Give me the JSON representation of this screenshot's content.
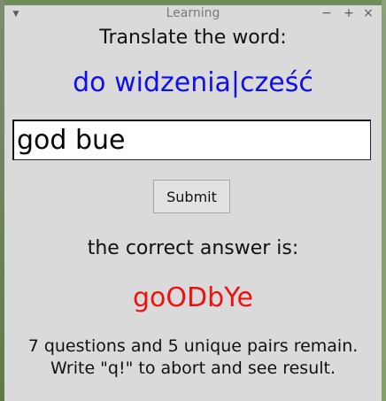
{
  "window": {
    "title": "Learning",
    "menu_icon": "chevron-down-icon",
    "controls": {
      "minimize": "−",
      "maximize": "+",
      "close": "×"
    }
  },
  "quiz": {
    "prompt": "Translate the word:",
    "word": "do widzenia|cześć",
    "input_value": "god bue",
    "submit_label": "Submit",
    "correct_label": "the correct answer is:",
    "correct_answer": "goODbYe",
    "status_line1": "7 questions and 5 unique pairs remain.",
    "status_line2": "Write \"q!\" to abort and see result."
  },
  "colors": {
    "word": "#1010ee",
    "correct_answer": "#ee1111",
    "window_bg": "#dadada"
  }
}
